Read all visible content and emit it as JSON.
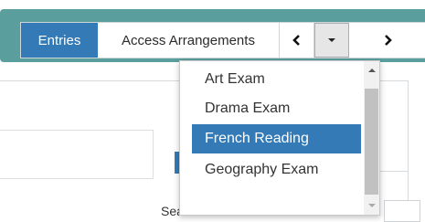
{
  "tabs": [
    {
      "label": "Entries",
      "active": true
    },
    {
      "label": "Access Arrangements",
      "active": false
    }
  ],
  "nav": {
    "prev_icon": "chevron-left-icon",
    "dropdown_icon": "caret-down-icon",
    "next_icon": "chevron-right-icon"
  },
  "dropdown": {
    "items": [
      "Art Exam",
      "Drama Exam",
      "French Reading",
      "Geography Exam"
    ],
    "selected": "French Reading"
  },
  "search": {
    "label": "Search:"
  },
  "colors": {
    "frame": "#5a9f9e",
    "accent": "#337ab7",
    "dropdown_button_bg": "#e6e6e6"
  }
}
